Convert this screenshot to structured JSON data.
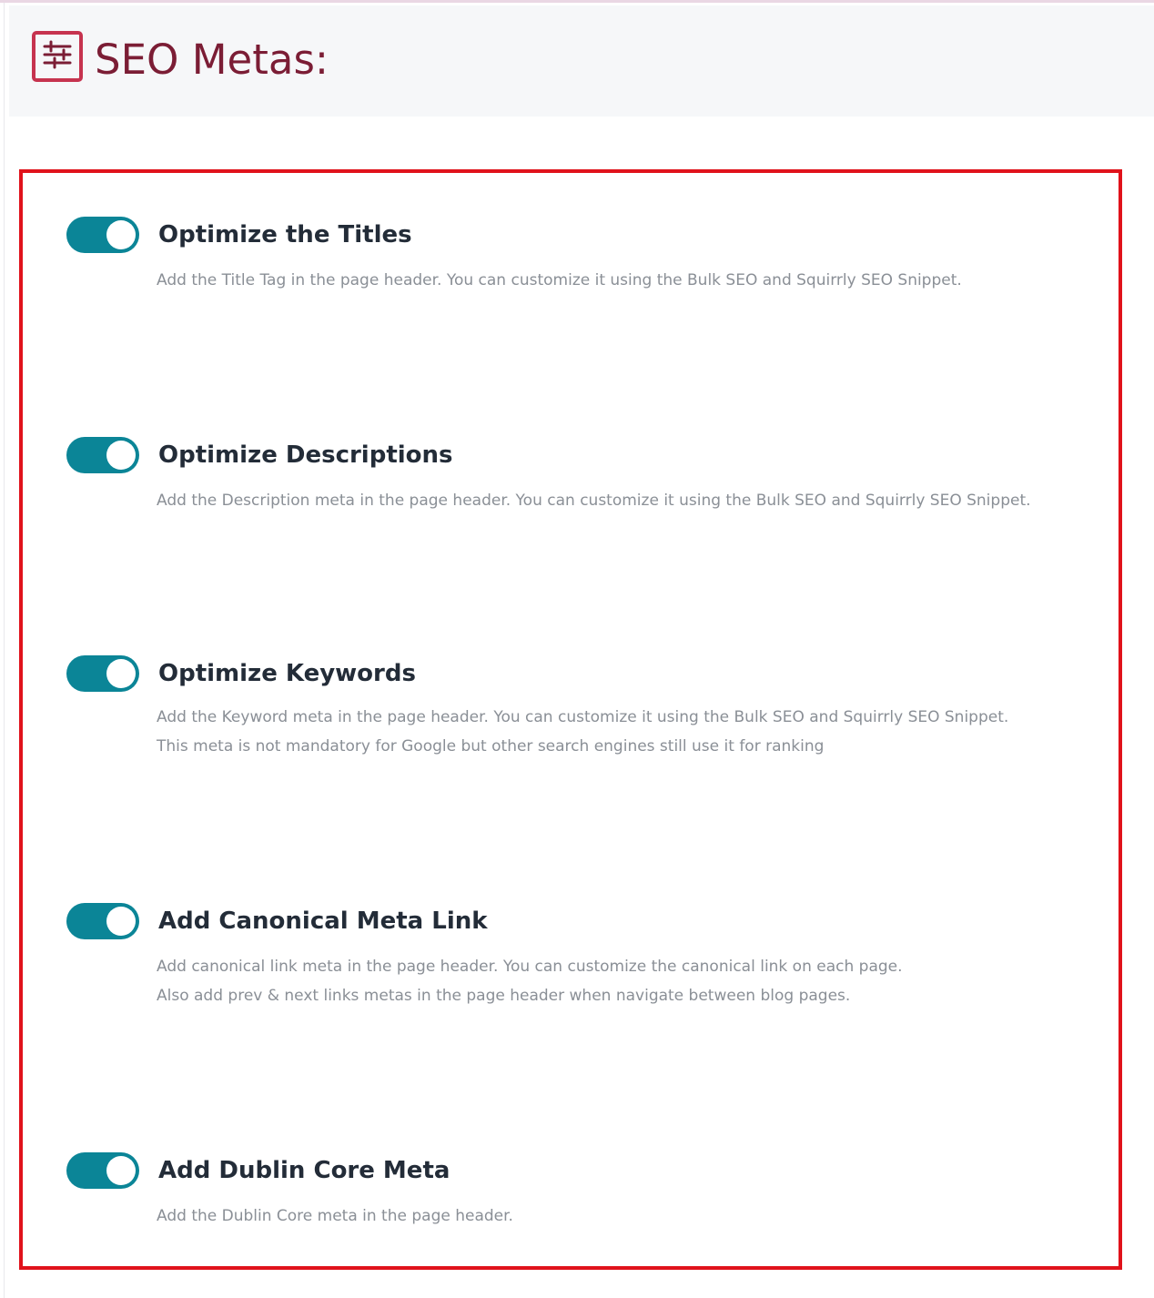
{
  "header": {
    "title": "SEO Metas:",
    "icon": "settings-list-icon",
    "title_color": "#7b1d35"
  },
  "colors": {
    "toggle_on": "#0b8597",
    "highlight_border": "#e0121b",
    "title_text": "#232c38",
    "description_text": "#8a8f96"
  },
  "options": [
    {
      "title": "Optimize the Titles",
      "enabled": true,
      "description": [
        "Add the Title Tag in the page header. You can customize it using the Bulk SEO and Squirrly SEO Snippet."
      ]
    },
    {
      "title": "Optimize Descriptions",
      "enabled": true,
      "description": [
        "Add the Description meta in the page header. You can customize it using the Bulk SEO and Squirrly SEO Snippet."
      ]
    },
    {
      "title": "Optimize Keywords",
      "enabled": true,
      "description": [
        "Add the Keyword meta in the page header. You can customize it using the Bulk SEO and Squirrly SEO Snippet.",
        "This meta is not mandatory for Google but other search engines still use it for ranking"
      ]
    },
    {
      "title": "Add Canonical Meta Link",
      "enabled": true,
      "description": [
        "Add canonical link meta in the page header. You can customize the canonical link on each page.",
        "Also add prev & next links metas in the page header when navigate between blog pages."
      ]
    },
    {
      "title": "Add Dublin Core Meta",
      "enabled": true,
      "description": [
        "Add the Dublin Core meta in the page header."
      ]
    }
  ]
}
